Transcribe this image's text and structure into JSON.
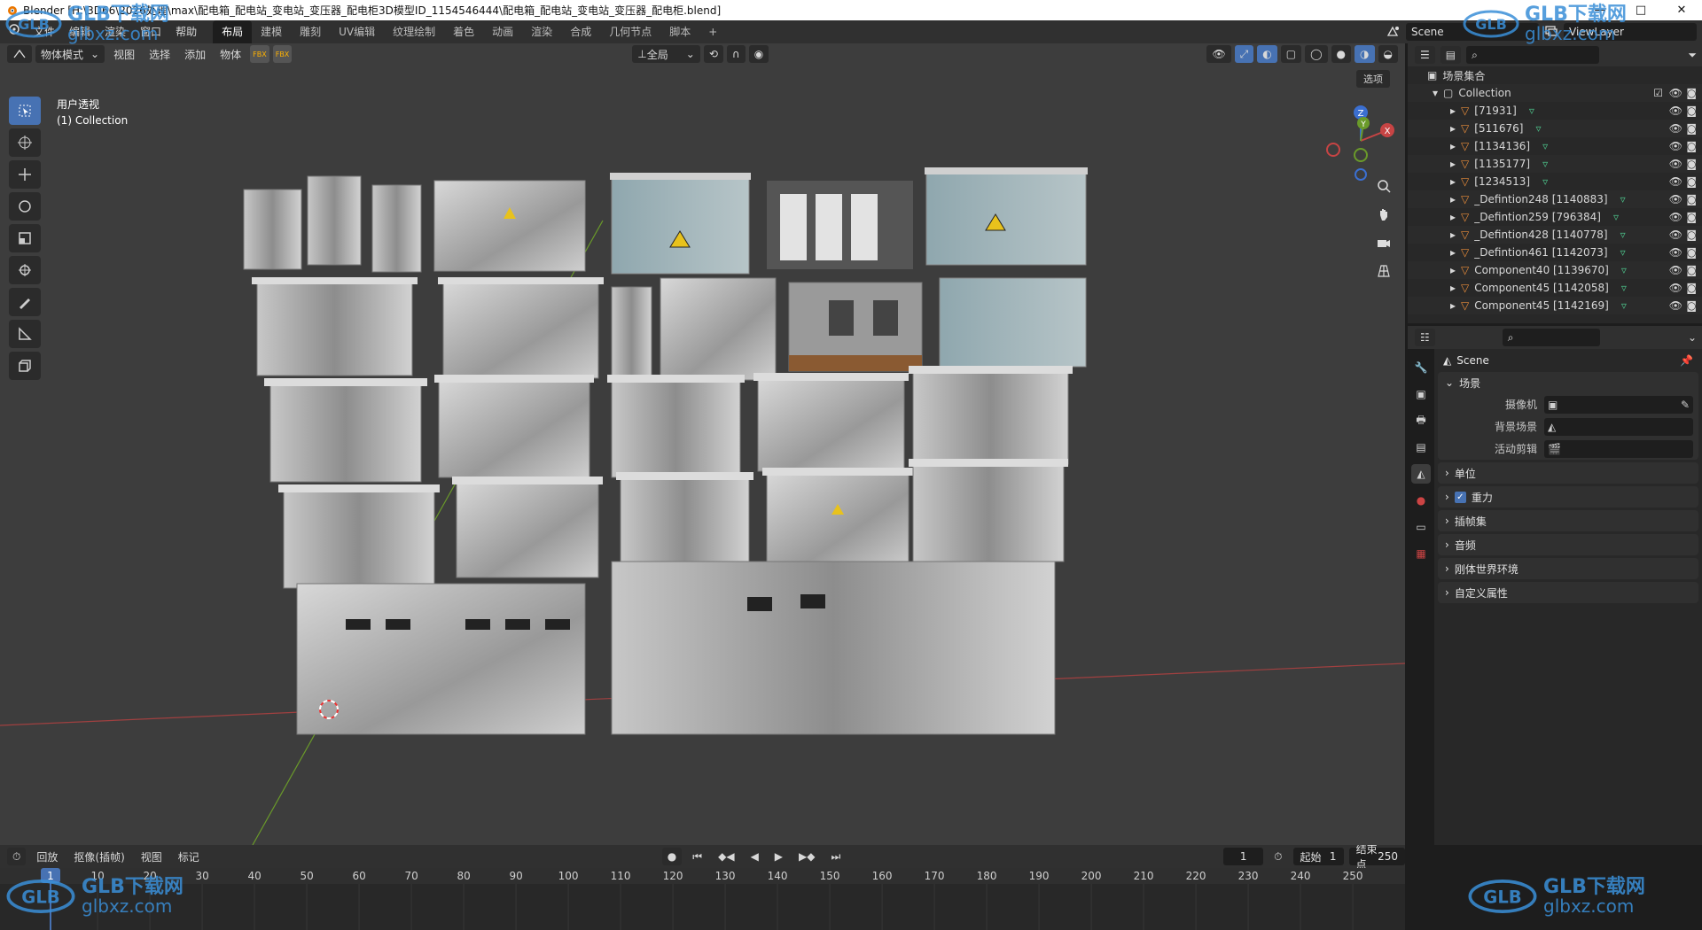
{
  "window": {
    "title": "Blender [H:\\3D66\\2026处理\\max\\配电箱_配电站_变电站_变压器_配电柜3D模型ID_1154546444\\配电箱_配电站_变电站_变压器_配电柜.blend]",
    "controls": [
      "—",
      "□",
      "✕"
    ]
  },
  "topbar": {
    "menus": [
      "文件",
      "编辑",
      "渲染",
      "窗口",
      "帮助"
    ],
    "workspaces": [
      "布局",
      "建模",
      "雕刻",
      "UV编辑",
      "纹理绘制",
      "着色",
      "动画",
      "渲染",
      "合成",
      "几何节点",
      "脚本"
    ],
    "active_workspace": "布局",
    "add_tab": "+",
    "scene": "Scene",
    "view_layer": "ViewLayer"
  },
  "viewport": {
    "mode": "物体模式",
    "menus": [
      "视图",
      "选择",
      "添加",
      "物体"
    ],
    "transform_orientation": "全局",
    "options_label": "选项",
    "view_name": "用户透视",
    "collection_info": "(1) Collection",
    "gizmo_axes": [
      "X",
      "Y",
      "Z"
    ]
  },
  "outliner": {
    "root": "场景集合",
    "collection": "Collection",
    "items": [
      "[71931]",
      "[511676]",
      "[1134136]",
      "[1135177]",
      "[1234513]",
      "_Defintion248 [1140883]",
      "_Defintion259 [796384]",
      "_Defintion428 [1140778]",
      "_Defintion461 [1142073]",
      "Component40 [1139670]",
      "Component45 [1142058]",
      "Component45 [1142169]"
    ]
  },
  "properties": {
    "context": "Scene",
    "scene_panel": {
      "title": "场景",
      "rows": [
        {
          "label": "摄像机",
          "value": ""
        },
        {
          "label": "背景场景",
          "value": ""
        },
        {
          "label": "活动剪辑",
          "value": ""
        }
      ]
    },
    "collapsed_panels": [
      "单位",
      "重力",
      "插帧集",
      "音频",
      "刚体世界环境",
      "自定义属性"
    ]
  },
  "timeline": {
    "menus": [
      "回放",
      "抠像(插帧)",
      "视图",
      "标记"
    ],
    "current_frame": "1",
    "start_label": "起始",
    "start_value": "1",
    "end_label": "结束点",
    "end_value": "250",
    "ruler_marks": [
      "1",
      "10",
      "20",
      "30",
      "40",
      "50",
      "60",
      "70",
      "80",
      "90",
      "100",
      "110",
      "120",
      "130",
      "140",
      "150",
      "160",
      "170",
      "180",
      "190",
      "200",
      "210",
      "220",
      "230",
      "240",
      "250"
    ]
  },
  "watermark": {
    "brand": "GLB下载网",
    "url": "glbxz.com"
  },
  "colors": {
    "accent": "#4772b3",
    "viewport_bg": "#3d3d3d",
    "x_axis": "#c74444",
    "y_axis": "#6a9a2a",
    "z_axis": "#3b6fd0",
    "playhead": "#4772b3"
  }
}
